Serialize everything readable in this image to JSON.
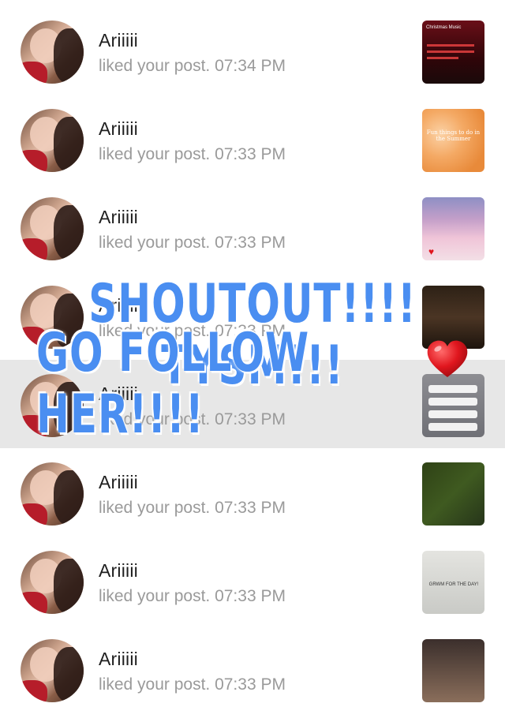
{
  "notifications": [
    {
      "name": "Ariiiii",
      "text": "liked your post. 07:34 PM",
      "thumb_text": "Christmas Music"
    },
    {
      "name": "Ariiiii",
      "text": "liked your post. 07:33 PM",
      "thumb_text": "Fun things to do in the Summer"
    },
    {
      "name": "Ariiiii",
      "text": "liked your post. 07:33 PM",
      "thumb_text": ""
    },
    {
      "name": "Ariiiii",
      "text": "liked your post. 07:33 PM",
      "thumb_text": ""
    },
    {
      "name": "Ariiiii",
      "text": "liked your post. 07:33 PM",
      "thumb_text": ""
    },
    {
      "name": "Ariiiii",
      "text": "liked your post. 07:33 PM",
      "thumb_text": ""
    },
    {
      "name": "Ariiiii",
      "text": "liked your post. 07:33 PM",
      "thumb_text": "GRWM FOR THE DAY!"
    },
    {
      "name": "Ariiiii",
      "text": "liked your post. 07:33 PM",
      "thumb_text": ""
    }
  ],
  "overlay": {
    "line1": "SHOUTOUT!!!! TYSM!!!",
    "line2": "GO FOLLOW HER!!!!",
    "heart_color": "#e0161e"
  },
  "colors": {
    "overlay_text": "#4a8ef1",
    "highlight_row": "#e7e7e7"
  }
}
